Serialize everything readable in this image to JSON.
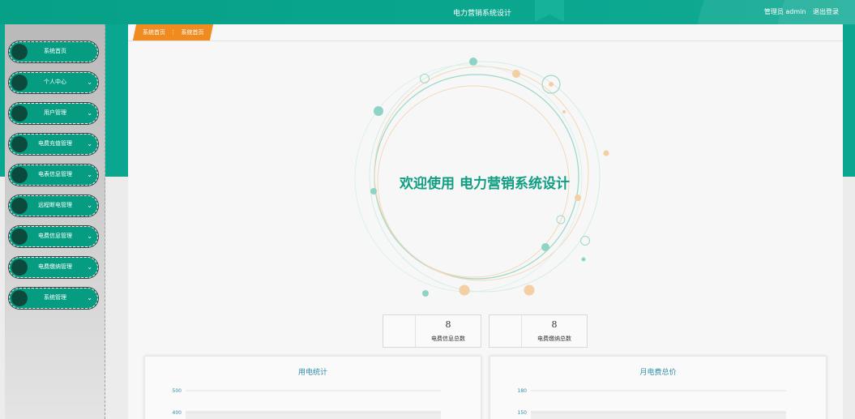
{
  "header": {
    "title": "电力营销系统设计",
    "user_text": "管理员 admin",
    "logout_label": "退出登录"
  },
  "sidebar": {
    "items": [
      {
        "label": "系统首页",
        "expandable": false
      },
      {
        "label": "个人中心",
        "expandable": true
      },
      {
        "label": "用户管理",
        "expandable": true
      },
      {
        "label": "电费充值管理",
        "expandable": true
      },
      {
        "label": "电表信息管理",
        "expandable": true
      },
      {
        "label": "远程断电管理",
        "expandable": true
      },
      {
        "label": "电费信息管理",
        "expandable": true
      },
      {
        "label": "电费缴纳管理",
        "expandable": true
      },
      {
        "label": "系统管理",
        "expandable": true
      }
    ]
  },
  "breadcrumb": {
    "items": [
      "系统首页",
      "系统首页"
    ],
    "separator": "⋮"
  },
  "welcome": {
    "text": "欢迎使用 电力营销系统设计"
  },
  "stats": [
    {
      "value": "8",
      "caption": "电费信息总数"
    },
    {
      "value": "8",
      "caption": "电费缴纳总数"
    }
  ],
  "colors": {
    "brand": "#0ba68f",
    "breadcrumb": "#ef8b1f",
    "welcome": "#109e82",
    "chart_title": "#2f8ea9"
  },
  "chart_data": [
    {
      "type": "bar",
      "title": "用电统计",
      "xlabel": "",
      "ylabel": "",
      "yticks": [
        500,
        400
      ],
      "series": []
    },
    {
      "type": "bar",
      "title": "月电费总价",
      "xlabel": "",
      "ylabel": "",
      "yticks": [
        180,
        150
      ],
      "series": []
    }
  ]
}
